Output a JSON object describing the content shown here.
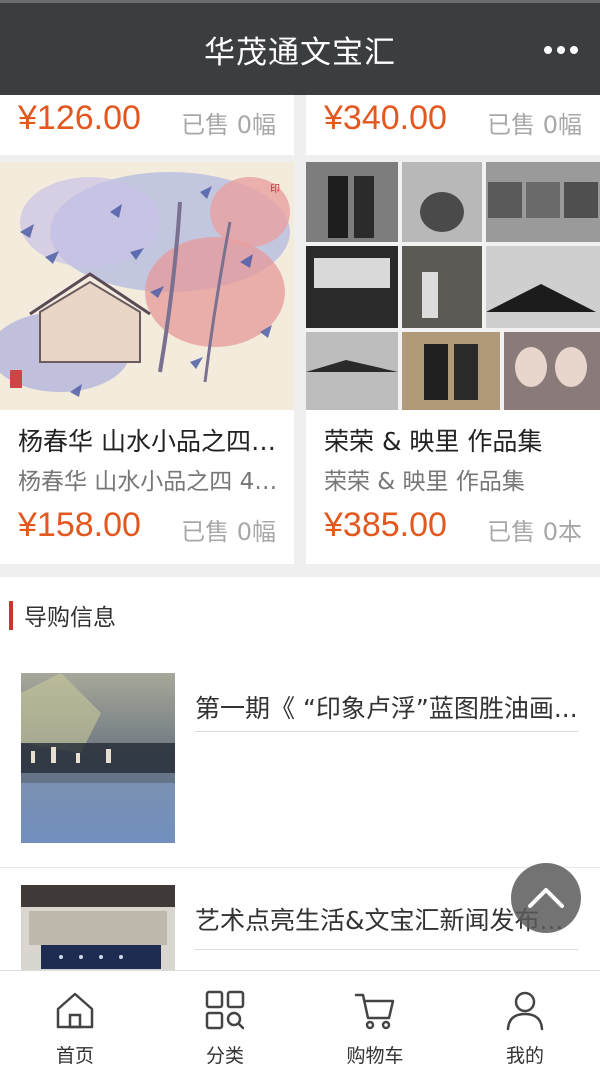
{
  "header": {
    "title": "华茂通文宝汇"
  },
  "top_row": [
    {
      "price": "¥126.00",
      "sold": "已售 0幅"
    },
    {
      "price": "¥340.00",
      "sold": "已售 0幅"
    }
  ],
  "products": [
    {
      "title": "杨春华 山水小品之四 ...",
      "subtitle": "杨春华 山水小品之四 46...",
      "price": "¥158.00",
      "sold": "已售 0幅"
    },
    {
      "title": "荣荣 & 映里 作品集",
      "subtitle": "荣荣 & 映里 作品集",
      "price": "¥385.00",
      "sold": "已售 0本"
    }
  ],
  "guide": {
    "section_title": "导购信息",
    "articles": [
      {
        "title": "第一期《 “印象卢浮”蓝图胜油画..."
      },
      {
        "title": "艺术点亮生活&文宝汇新闻发布..."
      }
    ]
  },
  "tabbar": [
    {
      "label": "首页",
      "icon": "home-icon"
    },
    {
      "label": "分类",
      "icon": "category-icon"
    },
    {
      "label": "购物车",
      "icon": "cart-icon"
    },
    {
      "label": "我的",
      "icon": "user-icon"
    }
  ],
  "colors": {
    "header": "#3b3d40",
    "price": "#e2581e",
    "accent_bar": "#d0332b"
  }
}
